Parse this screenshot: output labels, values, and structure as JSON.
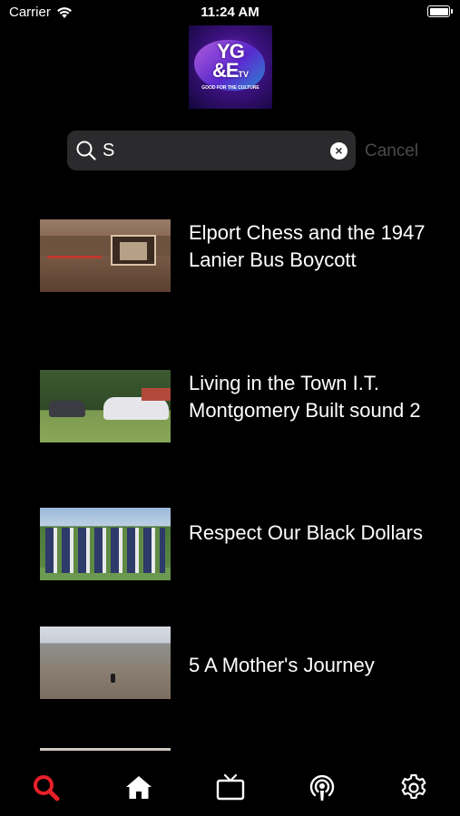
{
  "status_bar": {
    "carrier": "Carrier",
    "time": "11:24 AM"
  },
  "logo": {
    "line1": "YG",
    "line2": "&E",
    "tv": "TV",
    "tagline": "GOOD FOR THE CULTURE"
  },
  "search": {
    "value": "S",
    "cancel_label": "Cancel"
  },
  "results": [
    {
      "title": "Elport Chess and the 1947 Lanier Bus Boycott"
    },
    {
      "title": "Living in the Town I.T. Montgomery Built sound 2"
    },
    {
      "title": "Respect Our Black Dollars"
    },
    {
      "title": "5 A Mother's Journey"
    }
  ],
  "tab_bar": {
    "active_color": "#e8202a",
    "inactive_color": "#ffffff",
    "tabs": [
      "search-icon",
      "home-icon",
      "tv-icon",
      "podcast-icon",
      "gear-icon"
    ]
  }
}
